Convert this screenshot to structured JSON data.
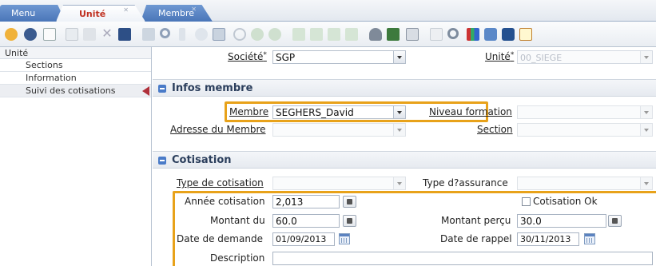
{
  "tabs": [
    {
      "label": "Menu",
      "closable": false
    },
    {
      "label": "Unité",
      "closable": true,
      "active": true
    },
    {
      "label": "Membre",
      "closable": true
    }
  ],
  "toolbar": {
    "icons": [
      "back-icon",
      "help-icon",
      "new-icon",
      "copy-icon",
      "delete-icon",
      "cancel-icon",
      "save-icon",
      "preview-icon",
      "search-icon",
      "attach-icon",
      "chat-icon",
      "grid-icon",
      "refresh-icon",
      "prev-icon",
      "next-icon",
      "first-icon",
      "up-icon",
      "down-icon",
      "last-icon",
      "archive-icon",
      "report-icon",
      "print-icon",
      "zoom-icon",
      "zoom-page-icon",
      "export-icon",
      "tool-icon",
      "stop-icon",
      "edit-icon"
    ]
  },
  "leftnav": {
    "header": "Unité",
    "items": [
      "Sections",
      "Information",
      "Suivi des cotisations"
    ]
  },
  "form": {
    "societe_label": "Société",
    "societe_value": "SGP",
    "unite_label": "Unité",
    "unite_value": "00_SIEGE",
    "required_mark": "*",
    "infos_title": "Infos membre",
    "membre_label": "Membre",
    "membre_value": "SEGHERS_David",
    "niveau_label": "Niveau formation",
    "adresse_label": "Adresse du Membre",
    "section_label": "Section",
    "cotisation_title": "Cotisation",
    "type_cot_label": "Type de cotisation",
    "type_ass_label": "Type d?assurance",
    "annee_label": "Année cotisation",
    "annee_value": "2,013",
    "cot_ok_label": "Cotisation Ok",
    "montant_du_label": "Montant du",
    "montant_du_value": "60.0",
    "montant_percu_label": "Montant perçu",
    "montant_percu_value": "30.0",
    "date_demande_label": "Date de demande",
    "date_demande_value": "01/09/2013",
    "date_rappel_label": "Date de rappel",
    "date_rappel_value": "30/11/2013",
    "description_label": "Description",
    "description_value": ""
  },
  "colors": {
    "highlight": "#e8a21a",
    "tab_blue": "#4a76b8",
    "active_tab_text": "#c03020",
    "section_icon": "#4a7bc8"
  }
}
